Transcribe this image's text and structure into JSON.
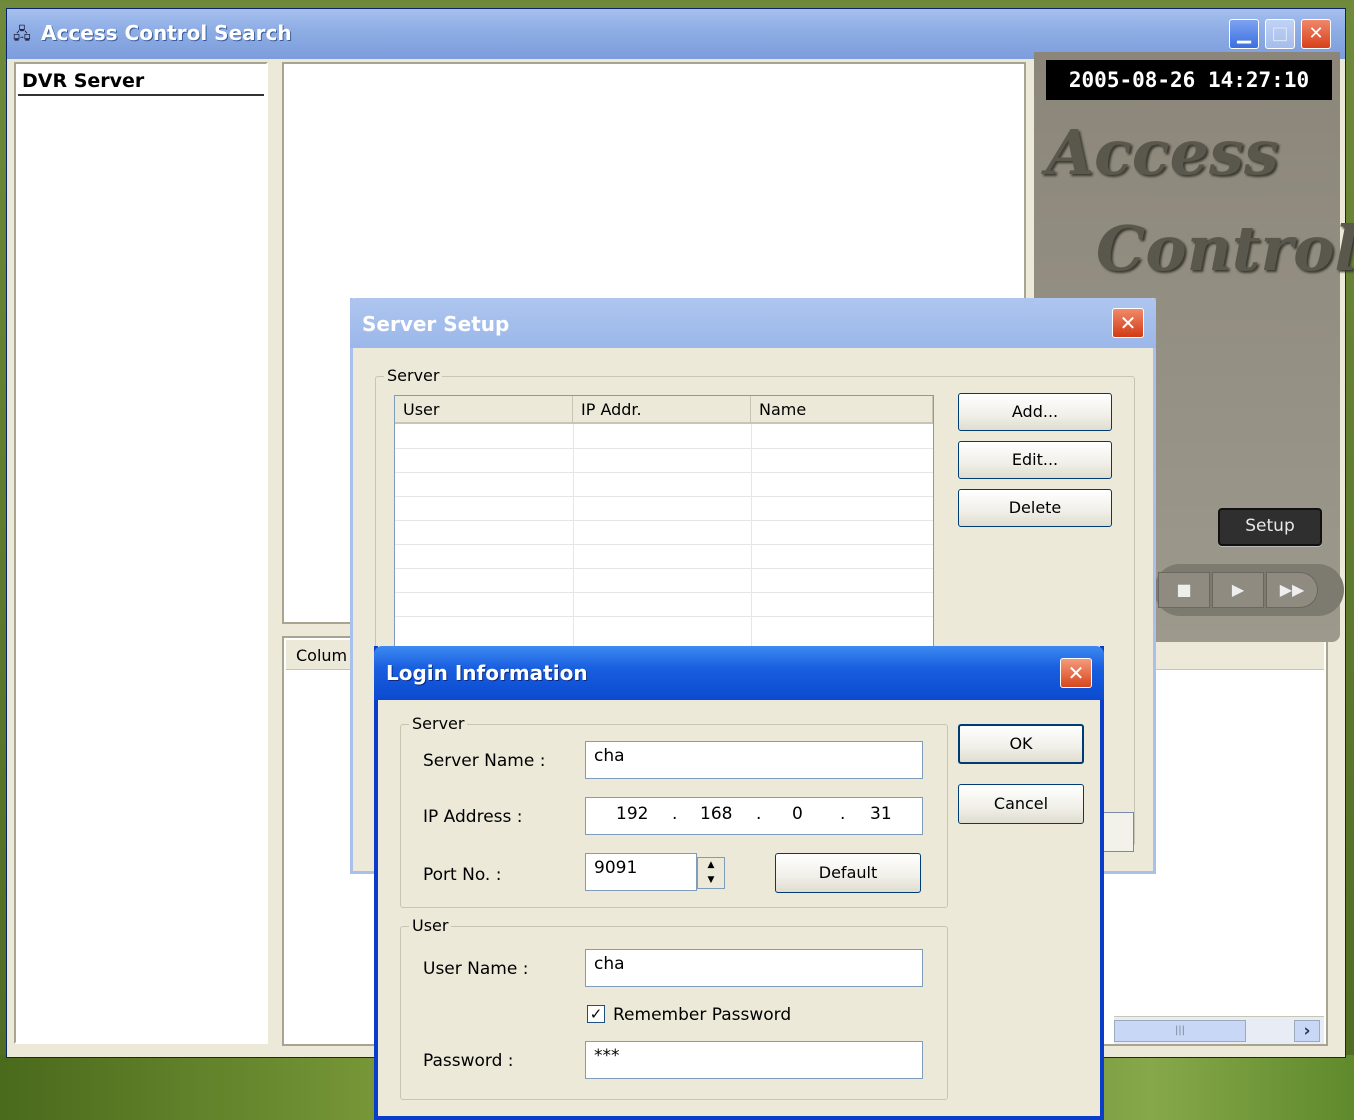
{
  "window": {
    "title": "Access Control Search"
  },
  "left_panel": {
    "header": "DVR Server"
  },
  "list_panel": {
    "column_header": "Colum"
  },
  "right_panel": {
    "clock": "2005-08-26 14:27:10",
    "logo_line1": "Access",
    "logo_line2": "Control",
    "setup_label": "Setup",
    "transport": [
      "■",
      "▶",
      "▶▶"
    ]
  },
  "server_setup": {
    "title": "Server Setup",
    "group_label": "Server",
    "columns": [
      "User",
      "IP Addr.",
      "Name"
    ],
    "buttons": {
      "add": "Add...",
      "edit": "Edit...",
      "delete": "Delete"
    }
  },
  "login": {
    "title": "Login Information",
    "server_group_label": "Server",
    "server_name_label": "Server Name :",
    "server_name_value": "cha",
    "ip_label": "IP Address :",
    "ip_octets": [
      "192",
      "168",
      "0",
      "31"
    ],
    "port_label": "Port No. :",
    "port_value": "9091",
    "default_label": "Default",
    "user_group_label": "User",
    "user_name_label": "User Name :",
    "user_name_value": "cha",
    "remember_label": "Remember Password",
    "remember_checked": true,
    "password_label": "Password :",
    "password_value": "***",
    "ok_label": "OK",
    "cancel_label": "Cancel"
  }
}
